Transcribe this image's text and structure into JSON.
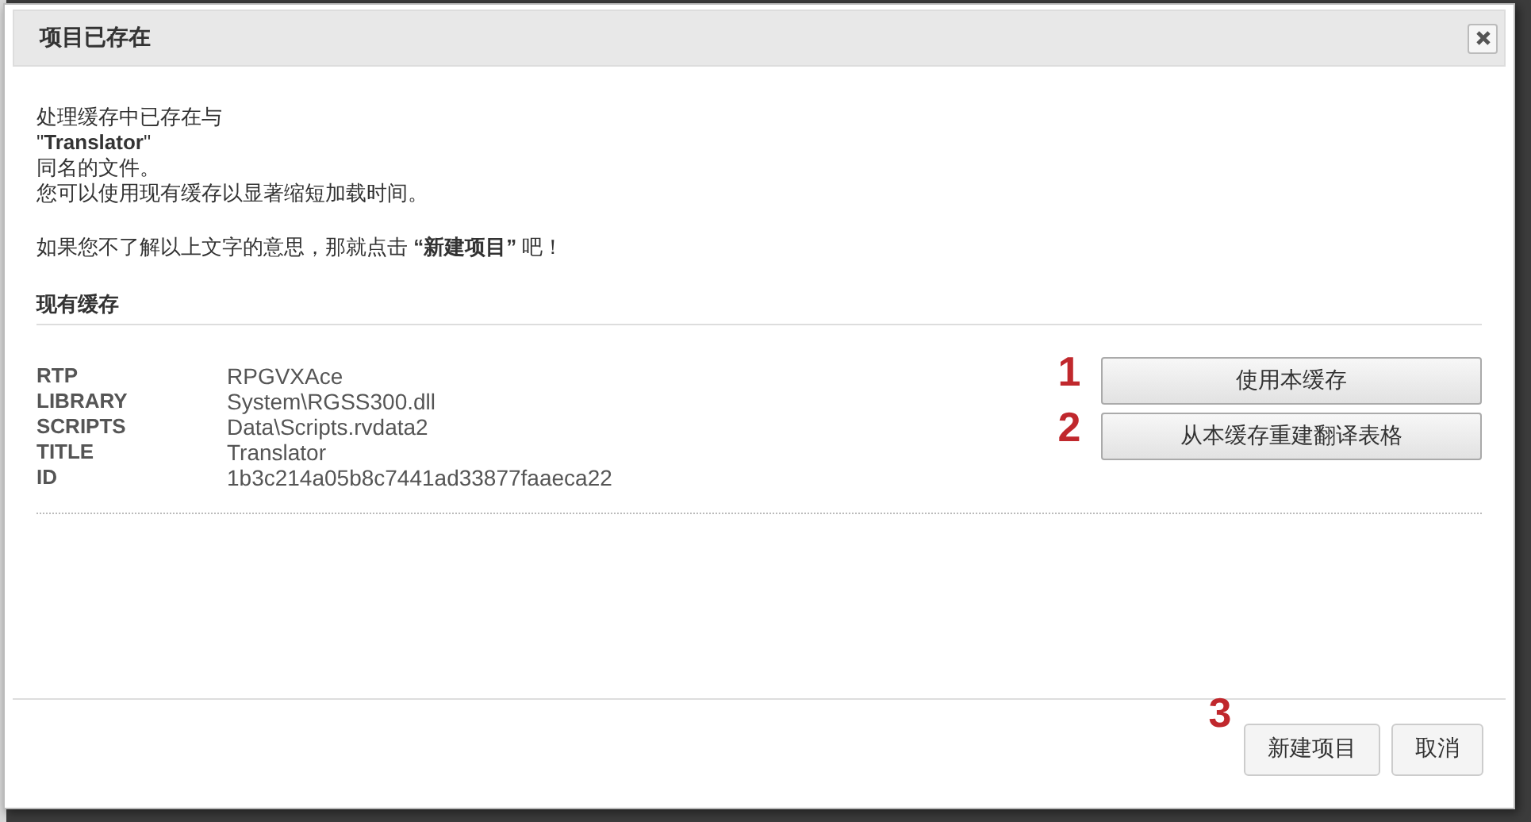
{
  "dialog": {
    "title": "项目已存在",
    "message_lines": [
      "处理缓存中已存在与",
      "\"**Translator**\"",
      "同名的文件。",
      "您可以使用现有缓存以显著缩短加载时间。"
    ],
    "hint": "如果您不了解以上文字的意思，那就点击 **“新建项目”** 吧！",
    "section_title": "现有缓存",
    "cache_info": [
      {
        "key": "RTP",
        "value": "RPGVXAce"
      },
      {
        "key": "LIBRARY",
        "value": "System\\RGSS300.dll"
      },
      {
        "key": "SCRIPTS",
        "value": "Data\\Scripts.rvdata2"
      },
      {
        "key": "TITLE",
        "value": "Translator"
      },
      {
        "key": "ID",
        "value": "1b3c214a05b8c7441ad33877faaeca22"
      }
    ],
    "cache_actions": [
      {
        "marker": "1",
        "label": "使用本缓存"
      },
      {
        "marker": "2",
        "label": "从本缓存重建翻译表格"
      }
    ],
    "footer_buttons": [
      {
        "marker": "3",
        "label": "新建项目"
      },
      {
        "label": "取消"
      }
    ]
  }
}
